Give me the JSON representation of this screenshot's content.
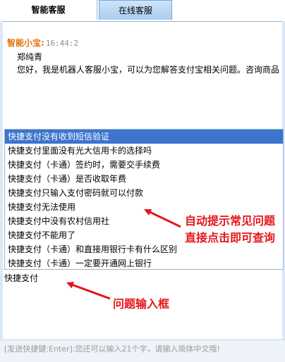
{
  "tabs": [
    {
      "label": "智能客服"
    },
    {
      "label": "在线客服"
    }
  ],
  "chat": {
    "sender": "智能小宝:",
    "time": "16:44:2",
    "name": "郑纯青",
    "text": "您好，我是机器人客服小宝，可以为您解答支付宝相关问题。咨询商品"
  },
  "suggestions": [
    {
      "label": "快捷支付没有收到短信验证"
    },
    {
      "label": "快捷支付里面没有光大信用卡的选择吗"
    },
    {
      "label": "快捷支付（卡通）签约时，需要交手续费"
    },
    {
      "label": "快捷支付（卡通）是否收取年费"
    },
    {
      "label": "快捷支付只输入支付密码就可以付款"
    },
    {
      "label": "快捷支付无法使用"
    },
    {
      "label": "快捷支付中没有农村信用社"
    },
    {
      "label": "快捷支付不能用了"
    },
    {
      "label": "快捷支付（卡通）和直接用银行卡有什么区别"
    },
    {
      "label": "快捷支付（卡通）一定要开通网上银行"
    }
  ],
  "input": {
    "value": "快捷支付"
  },
  "status": {
    "text": "[发送快捷键:Enter]:您还可以输入21个字，请输入简体中文哦!"
  },
  "annotations": {
    "suggest_line1": "自动提示常见问题",
    "suggest_line2": "直接点击即可查询",
    "input_label": "问题输入框"
  },
  "colors": {
    "annotation": "#e5161b",
    "selected_row": "#3c74ce",
    "sender": "#e0730d"
  }
}
